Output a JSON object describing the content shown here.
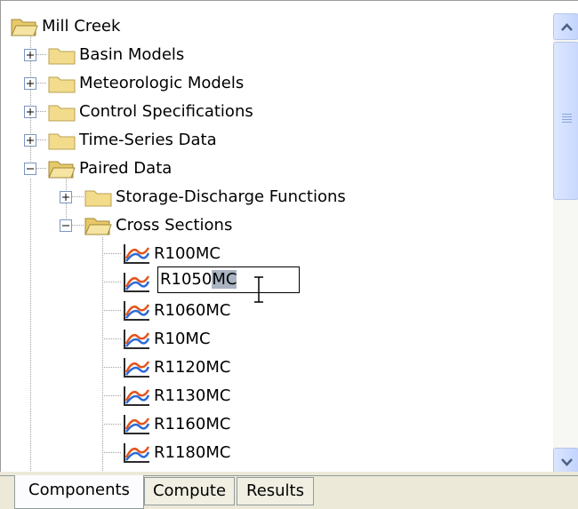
{
  "tree": {
    "root": {
      "label": "Mill Creek",
      "icon": "folder-open-icon"
    },
    "items": [
      {
        "label": "Basin Models",
        "expander": "plus"
      },
      {
        "label": "Meteorologic Models",
        "expander": "plus"
      },
      {
        "label": "Control Specifications",
        "expander": "plus"
      },
      {
        "label": "Time-Series Data",
        "expander": "plus"
      },
      {
        "label": "Paired Data",
        "expander": "minus"
      },
      {
        "label": "Storage-Discharge Functions",
        "expander": "plus"
      },
      {
        "label": "Cross Sections",
        "expander": "minus"
      }
    ],
    "cross_sections": [
      {
        "label": "R100MC"
      },
      {
        "label": "R1050MC",
        "editing": true
      },
      {
        "label": "R1060MC"
      },
      {
        "label": "R10MC"
      },
      {
        "label": "R1120MC"
      },
      {
        "label": "R1130MC"
      },
      {
        "label": "R1160MC"
      },
      {
        "label": "R1180MC"
      }
    ],
    "edit": {
      "prefix": "R1050",
      "selected": "MC"
    }
  },
  "tabs": [
    {
      "label": "Components",
      "active": true
    },
    {
      "label": "Compute",
      "active": false
    },
    {
      "label": "Results",
      "active": false
    }
  ],
  "colors": {
    "folder": "#f2dc8c",
    "selection": "#aab3c2",
    "tree_lines": "#a0a0a0",
    "tab_bg": "#ece9d8"
  }
}
